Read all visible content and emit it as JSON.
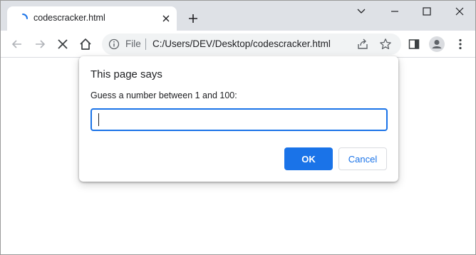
{
  "tab": {
    "title": "codescracker.html",
    "loading_icon": "loading-spinner-icon",
    "close_icon": "close-icon"
  },
  "new_tab_icon": "plus-icon",
  "window_controls": [
    "chevron-down-icon",
    "minimize-icon",
    "maximize-icon",
    "close-icon"
  ],
  "toolbar": {
    "back_icon": "arrow-left-icon",
    "forward_icon": "arrow-right-icon",
    "stop_icon": "stop-x-icon",
    "home_icon": "home-icon",
    "omnibox": {
      "info_icon": "info-icon",
      "scheme_label": "File",
      "url": "C:/Users/DEV/Desktop/codescracker.html",
      "share_icon": "share-icon",
      "bookmark_icon": "star-icon"
    },
    "side_panel_icon": "side-panel-icon",
    "profile_icon": "profile-avatar-icon",
    "menu_icon": "kebab-menu-icon"
  },
  "dialog": {
    "title": "This page says",
    "message": "Guess a number between 1 and 100:",
    "input_value": "",
    "ok_label": "OK",
    "cancel_label": "Cancel"
  },
  "colors": {
    "accent": "#1a73e8",
    "tabstrip_bg": "#dee1e6",
    "omnibox_bg": "#f1f3f4"
  }
}
